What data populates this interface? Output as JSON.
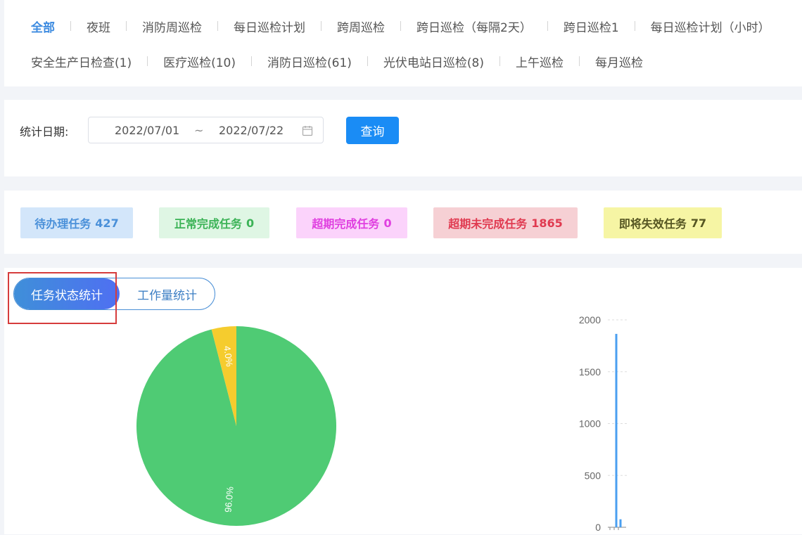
{
  "tabs": {
    "row1": [
      "全部",
      "夜班",
      "消防周巡检",
      "每日巡检计划",
      "跨周巡检",
      "跨日巡检（每隔2天）",
      "跨日巡检1",
      "每日巡检计划（小时）"
    ],
    "row2": [
      "安全生产日检查(1)",
      "医疗巡检(10)",
      "消防日巡检(61)",
      "光伏电站日巡检(8)",
      "上午巡检",
      "每月巡检"
    ],
    "active": "全部"
  },
  "filter": {
    "label": "统计日期:",
    "start": "2022/07/01",
    "separator": "~",
    "end": "2022/07/22",
    "query_button": "查询"
  },
  "stats": [
    {
      "label": "待办理任务",
      "value": "427",
      "color": "#4a90d9",
      "bg": "#d3e6fa"
    },
    {
      "label": "正常完成任务",
      "value": "0",
      "color": "#3cb357",
      "bg": "#dff6e4"
    },
    {
      "label": "超期完成任务",
      "value": "0",
      "color": "#e03fe0",
      "bg": "#fbd3fb"
    },
    {
      "label": "超期未完成任务",
      "value": "1865",
      "color": "#e03a50",
      "bg": "#f6d0d4"
    },
    {
      "label": "即将失效任务",
      "value": "77",
      "color": "#555522",
      "bg": "#f6f5a4"
    }
  ],
  "chart_toggle": {
    "active": "任务状态统计",
    "other": "工作量统计"
  },
  "chart_data": [
    {
      "type": "pie",
      "slices": [
        {
          "label": "4.0%",
          "value": 4.0,
          "color": "#f5cc2e"
        },
        {
          "label": "96.0%",
          "value": 96.0,
          "color": "#4fcb74"
        }
      ]
    },
    {
      "type": "bar",
      "ylim": [
        0,
        2000
      ],
      "yticks": [
        "0",
        "500",
        "1000",
        "1500",
        "2000"
      ],
      "values": [
        0,
        1865,
        77
      ],
      "color": "#4a9ff0"
    }
  ]
}
